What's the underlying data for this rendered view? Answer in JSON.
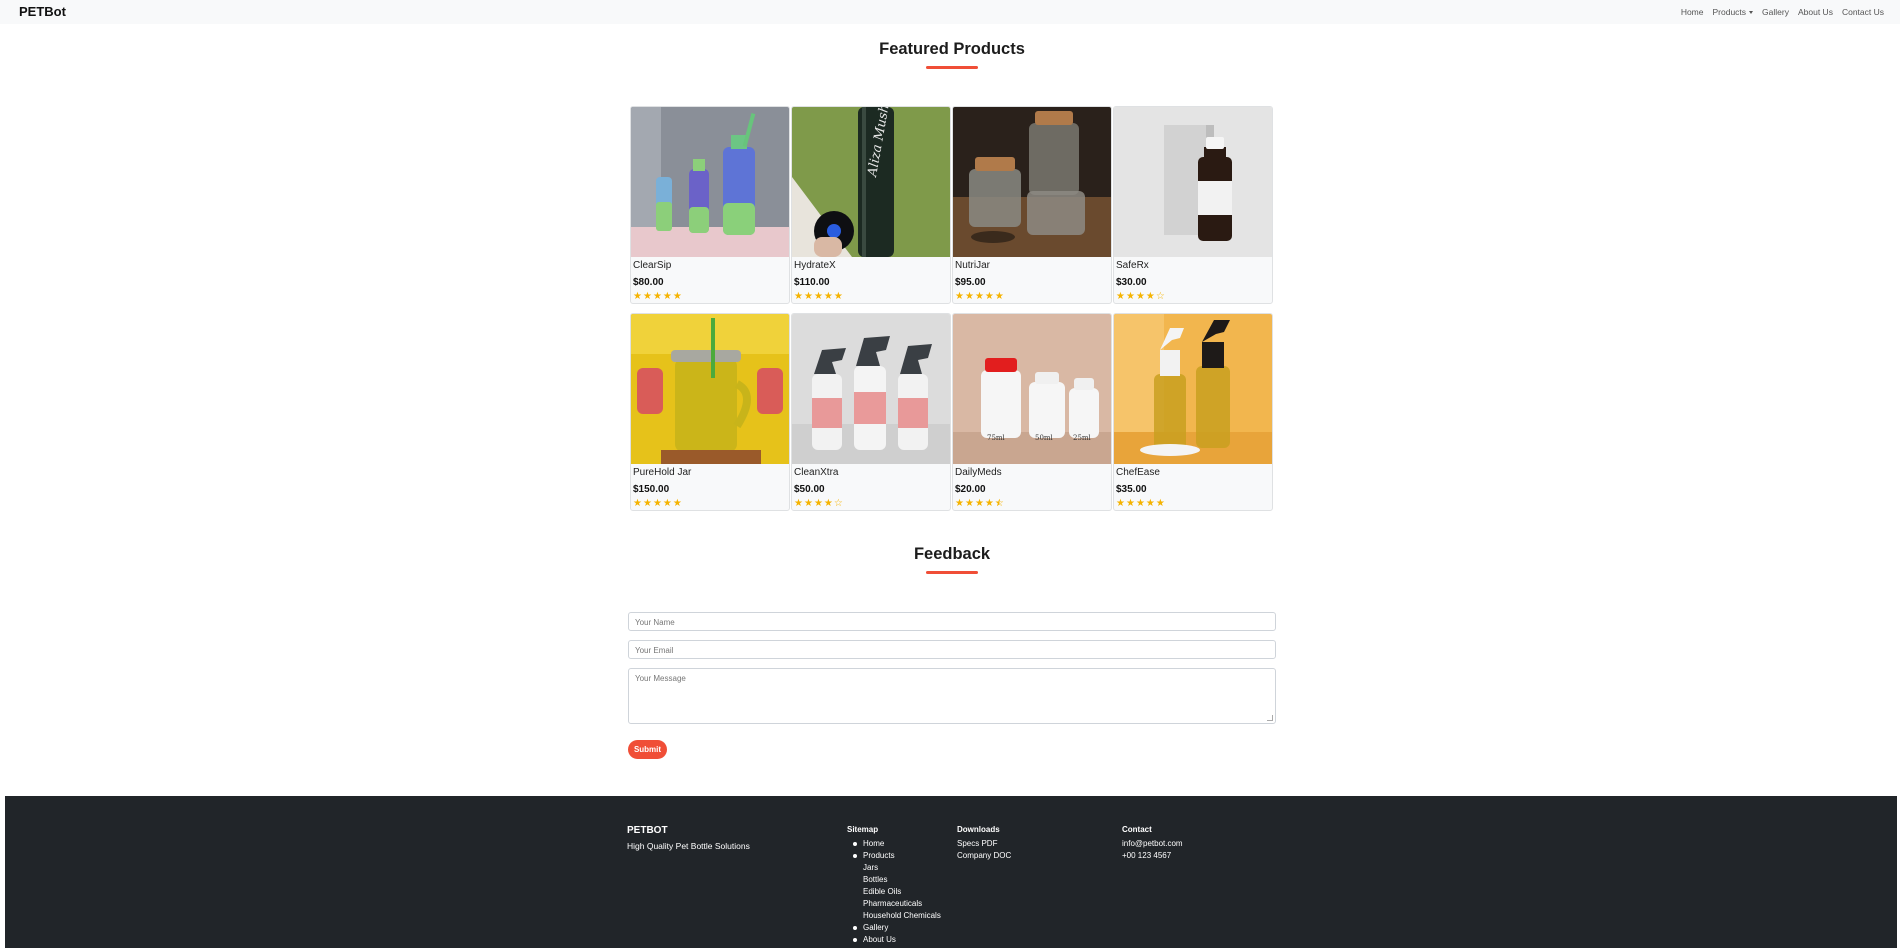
{
  "navbar": {
    "brand": "PETBot",
    "links": [
      "Home",
      "Products",
      "Gallery",
      "About Us",
      "Contact Us"
    ]
  },
  "featured": {
    "title": "Featured Products",
    "products": [
      {
        "name": "ClearSip",
        "price": "$80.00",
        "rating": 5
      },
      {
        "name": "HydrateX",
        "price": "$110.00",
        "rating": 5
      },
      {
        "name": "NutriJar",
        "price": "$95.00",
        "rating": 5
      },
      {
        "name": "SafeRx",
        "price": "$30.00",
        "rating": 4
      },
      {
        "name": "PureHold Jar",
        "price": "$150.00",
        "rating": 5
      },
      {
        "name": "CleanXtra",
        "price": "$50.00",
        "rating": 4
      },
      {
        "name": "DailyMeds",
        "price": "$20.00",
        "rating": 4.5
      },
      {
        "name": "ChefEase",
        "price": "$35.00",
        "rating": 5
      }
    ]
  },
  "feedback": {
    "title": "Feedback",
    "name_placeholder": "Your Name",
    "email_placeholder": "Your Email",
    "message_placeholder": "Your Message",
    "submit_label": "Submit"
  },
  "footer": {
    "brand": "PETBOT",
    "tagline": "High Quality Pet Bottle Solutions",
    "sitemap": {
      "heading": "Sitemap",
      "items": [
        "Home",
        "Products",
        "Jars",
        "Bottles",
        "Edible Oils",
        "Pharmaceuticals",
        "Household Chemicals",
        "Gallery",
        "About Us"
      ]
    },
    "downloads": {
      "heading": "Downloads",
      "items": [
        "Specs PDF",
        "Company DOC"
      ]
    },
    "contact": {
      "heading": "Contact",
      "email": "info@petbot.com",
      "phone": "+00 123 4567"
    }
  },
  "colors": {
    "accent": "#f04e37",
    "star": "#f5b301",
    "footer_bg": "#212529",
    "navbar_bg": "#f8f9fa"
  }
}
